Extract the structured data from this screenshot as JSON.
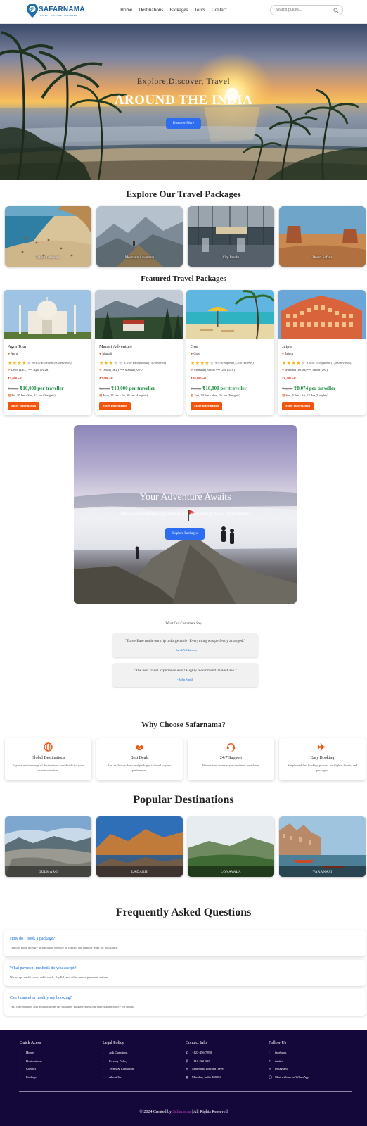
{
  "header": {
    "logo_name": "SAFARNAMA",
    "logo_tagline": "TRAVEL · EXPLORE · DISCOVER",
    "nav": [
      "Home",
      "Destinations",
      "Packages",
      "Tours",
      "Contact"
    ],
    "search_placeholder": "Search places..."
  },
  "hero": {
    "subtitle": "Explore,Discover, Travel",
    "title": "AROUND THE INDIA",
    "button": "Discover More"
  },
  "explore": {
    "title": "Explore Our Travel Packages",
    "cards": [
      "Beach Getaways",
      "Mountain Adventure",
      "City Breaks",
      "Desert Safaris"
    ]
  },
  "featured": {
    "title": "Featured Travel Packages",
    "cards": [
      {
        "title": "Agra Tour",
        "location": "Agra",
        "stars": 4,
        "rating": "9.0/10 Excellent (900 reviews)",
        "route": "Delhi (DEL) ⟶ Agra (AGR)",
        "discount": "₹5,000 off",
        "old_price": "₹15,000",
        "price": "₹10,000 per traveller",
        "dates": "Fri, 10 Jan - Sun, 12 Jan (2 nights)",
        "button": "More Information"
      },
      {
        "title": "Manali Adventure",
        "location": "Manali",
        "stars": 3,
        "rating": "8.5/10 Exceptional (750 reviews)",
        "route": "Delhi (DEL) ⟶ Manali (KUU)",
        "discount": "₹7,000 off",
        "old_price": "₹20,000",
        "price": "₹13,000 per traveller",
        "dates": "Mon, 15 Jan - Fri, 19 Jan (4 nights)",
        "button": "More Information"
      },
      {
        "title": "Goa",
        "location": "Goa",
        "stars": 4,
        "rating": "9.5/10 Superb (1,200 reviews)",
        "route": "Mumbai (BOM) ⟶ Goa (GOI)",
        "discount": "₹10,000 off",
        "old_price": "₹20,000",
        "price": "₹10,000 per traveller",
        "dates": "Tue, 20 Jan - Mon, 26 Jan (6 nights)",
        "button": "More Information"
      },
      {
        "title": "Jaipur",
        "location": "Jaipur",
        "stars": 4,
        "rating": "8.8/10 Exceptional (1,000 reviews)",
        "route": "Mumbai (BOM) ⟶ Jaipur (JAI)",
        "discount": "₹6,495 off",
        "old_price": "₹14,569",
        "price": "₹8,074 per traveller",
        "dates": "Sun, 5 Jan - Sat, 11 Jan (6 nights)",
        "button": "More Information"
      }
    ]
  },
  "adventure": {
    "title": "Your Adventure Awaits",
    "subtitle": "Discover breathtaking destinations and unforgettable experiences.",
    "button": "Explore Packages"
  },
  "testimonials": {
    "heading": "What Our Customers Say",
    "items": [
      {
        "quote": "\"TravelEase made our trip unforgettable! Everything was perfectly arranged.\"",
        "author": "- Sarah Wilkinson"
      },
      {
        "quote": "\"The best travel experience ever! Highly recommend TravelEase.\"",
        "author": "- John Smith"
      }
    ]
  },
  "why": {
    "title": "Why Choose Safarnama?",
    "cards": [
      {
        "icon": "globe-icon",
        "title": "Global Destinations",
        "desc": "Explore a wide range of destinations worldwide for your dream vacation."
      },
      {
        "icon": "handshake-icon",
        "title": "Best Deals",
        "desc": "Get exclusive deals and packages tailored to your preferences."
      },
      {
        "icon": "headset-icon",
        "title": "24/7 Support",
        "desc": "We are here to assist you anytime, anywhere."
      },
      {
        "icon": "plane-icon",
        "title": "Easy Booking",
        "desc": "Simple and fast booking process for flights, hotels, and packages."
      }
    ]
  },
  "popular": {
    "title": "Popular Destinations",
    "cards": [
      "GULMARG",
      "LADAKH",
      "LONAVALA",
      "VARANASI"
    ]
  },
  "faq": {
    "title": "Frequently Asked Questions",
    "items": [
      {
        "q": "How do I book a package?",
        "a": "You can book directly through our website or contact our support team for assistance."
      },
      {
        "q": "What payment methods do you accept?",
        "a": "We accept credit cards, debit cards, PayPal, and other secure payment options."
      },
      {
        "q": "Can I cancel or modify my booking?",
        "a": "Yes, cancellations and modifications are possible. Please review our cancellation policy for details."
      }
    ]
  },
  "footer": {
    "quick_title": "Quick Acess",
    "quick": [
      "Home",
      "Destinations",
      "Contact",
      "Package"
    ],
    "legal_title": "Legal Policy",
    "legal": [
      "Ask Questions",
      "Privacy Policy",
      "Terms & Condition",
      "About Us"
    ],
    "contact_title": "Contact Info",
    "contact": [
      "+123-456-7890",
      "+111-222-333",
      "SafarnamaTourandTravel",
      "Mumbai, India-400104"
    ],
    "follow_title": "Follow Us",
    "follow": [
      "facebook",
      "twitter",
      "instagram",
      "Chat with us on WhatsApp"
    ],
    "copy_prefix": "© 2024 Created by",
    "copy_brand": "Safarnama",
    "copy_suffix": "| All Rights Reserved"
  }
}
